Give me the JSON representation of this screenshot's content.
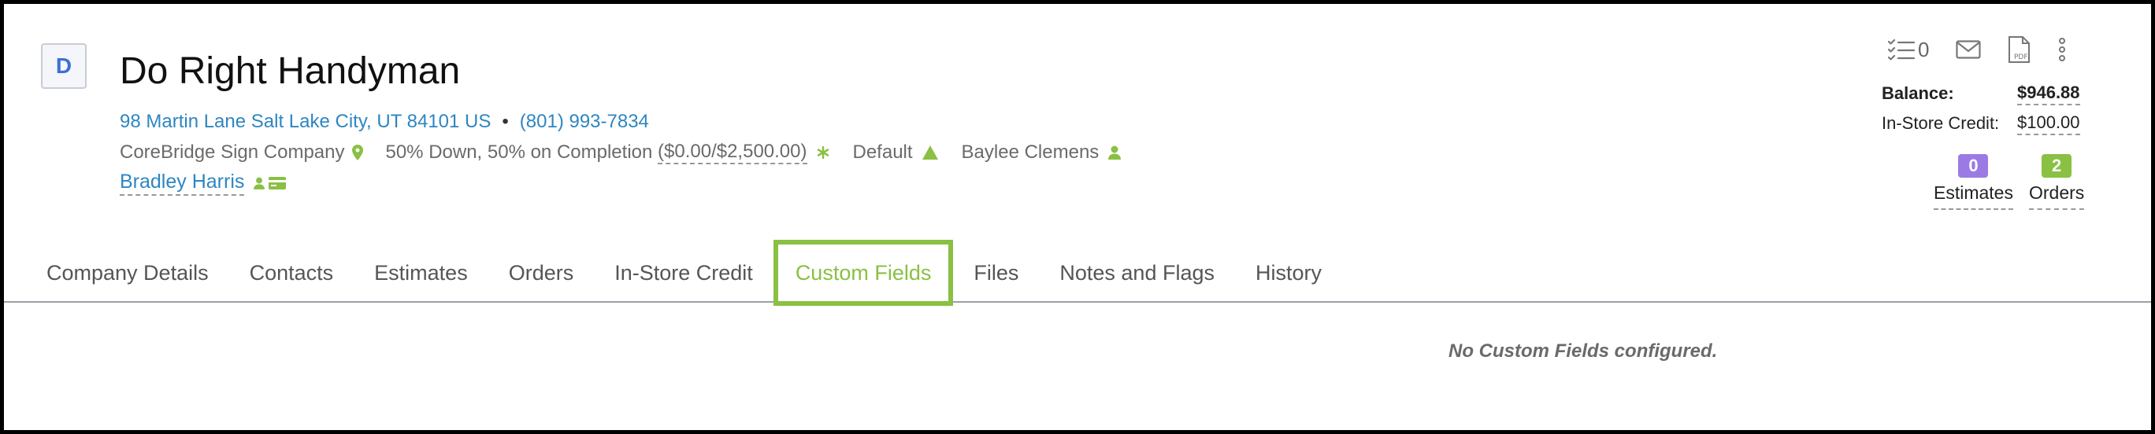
{
  "company": {
    "name": "Do Right Handyman",
    "logo_letter": "D",
    "address": "98 Martin Lane Salt Lake City, UT 84101 US",
    "separator": "•",
    "phone": "(801) 993-7834",
    "location": "CoreBridge Sign Company",
    "terms_prefix": "50% Down, 50% on Completion ",
    "terms_amounts": "($0.00/$2,500.00)",
    "pricing": "Default",
    "salesperson": "Baylee Clemens",
    "contact_name": "Bradley Harris"
  },
  "toolbar": {
    "task_count": "0"
  },
  "balances": {
    "balance_label": "Balance:",
    "balance_value": "$946.88",
    "credit_label": "In-Store Credit:",
    "credit_value": "$100.00"
  },
  "counters": [
    {
      "count": "0",
      "label": "Estimates",
      "color": "#9b7be3"
    },
    {
      "count": "2",
      "label": "Orders",
      "color": "#8ac043"
    }
  ],
  "tabs": [
    {
      "label": "Company Details"
    },
    {
      "label": "Contacts"
    },
    {
      "label": "Estimates"
    },
    {
      "label": "Orders"
    },
    {
      "label": "In-Store Credit"
    },
    {
      "label": "Custom Fields",
      "active": true
    },
    {
      "label": "Files"
    },
    {
      "label": "Notes and Flags"
    },
    {
      "label": "History"
    }
  ],
  "empty_message": "No Custom Fields configured.",
  "colors": {
    "accent": "#8ac043",
    "link": "#2e86c1",
    "purple": "#9b7be3"
  }
}
